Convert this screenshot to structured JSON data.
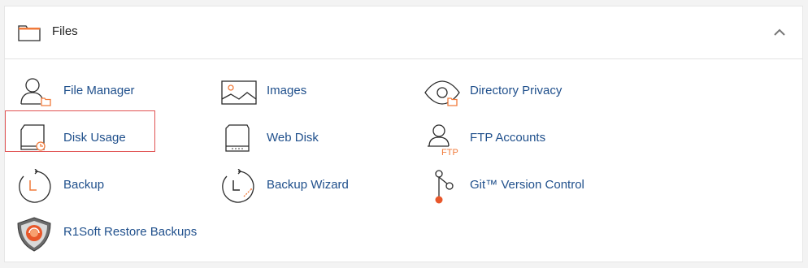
{
  "section": {
    "title": "Files",
    "collapse_icon": "chevron-up-icon"
  },
  "items": [
    {
      "label": "File Manager",
      "icon": "file-manager-icon"
    },
    {
      "label": "Images",
      "icon": "images-icon"
    },
    {
      "label": "Directory Privacy",
      "icon": "directory-privacy-icon"
    },
    {
      "label": "Disk Usage",
      "icon": "disk-usage-icon",
      "highlighted": true
    },
    {
      "label": "Web Disk",
      "icon": "web-disk-icon"
    },
    {
      "label": "FTP Accounts",
      "icon": "ftp-accounts-icon",
      "icon_text": "FTP"
    },
    {
      "label": "Backup",
      "icon": "backup-icon"
    },
    {
      "label": "Backup Wizard",
      "icon": "backup-wizard-icon"
    },
    {
      "label": "Git™ Version Control",
      "icon": "git-version-control-icon"
    },
    {
      "label": "R1Soft Restore Backups",
      "icon": "r1soft-shield-icon"
    }
  ],
  "colors": {
    "link": "#20508c",
    "accent": "#f07a3a",
    "highlight_border": "#e05252",
    "icon_stroke": "#2b2b2b"
  }
}
